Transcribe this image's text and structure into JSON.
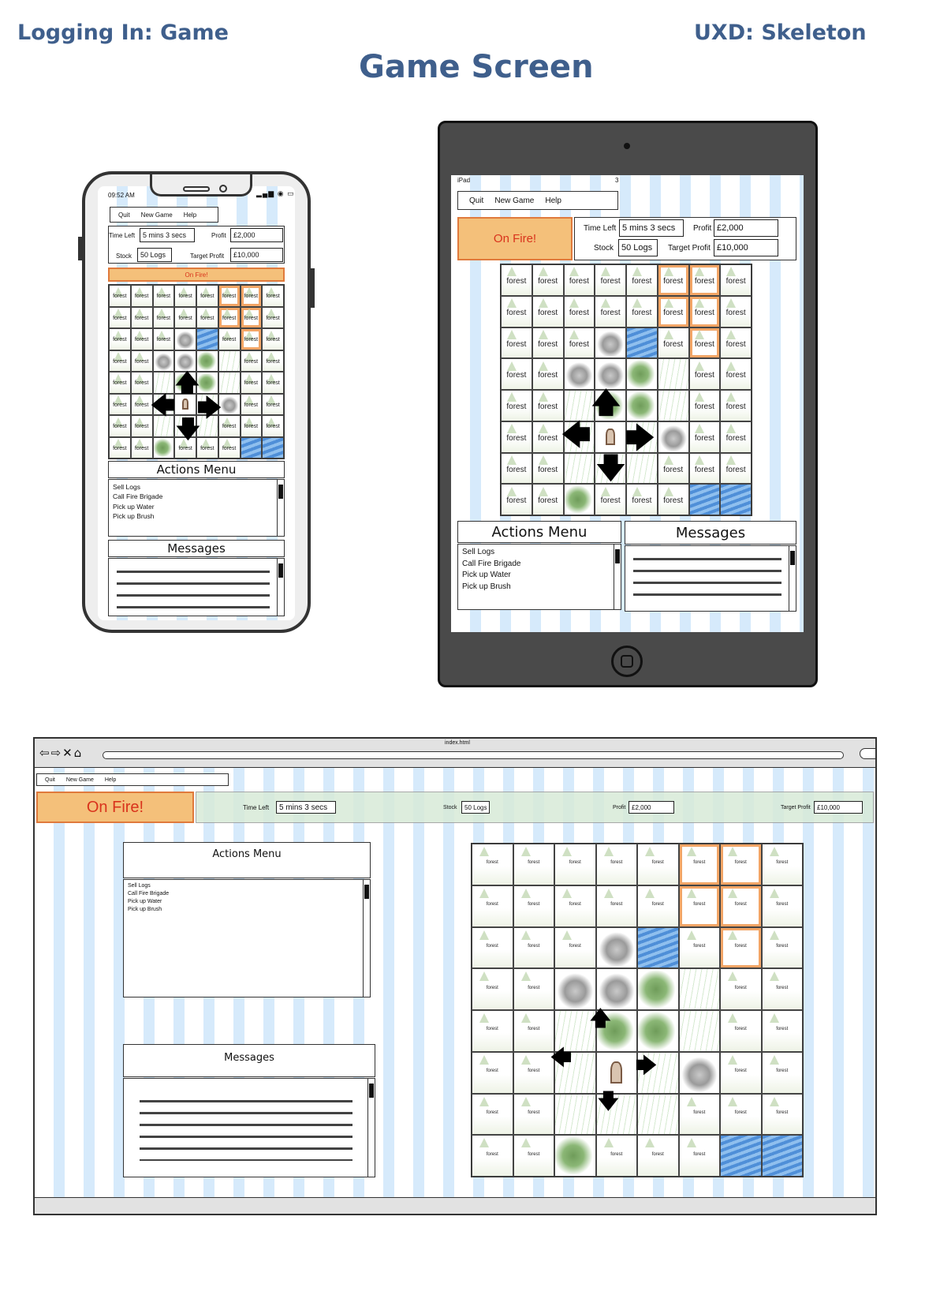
{
  "header": {
    "left": "Logging In: Game",
    "right": "UXD: Skeleton",
    "title": "Game Screen"
  },
  "menu": {
    "quit": "Quit",
    "new_game": "New Game",
    "help": "Help"
  },
  "status": {
    "alert": "On Fire!",
    "time_left_label": "Time Left",
    "time_left_value": "5 mins 3 secs",
    "profit_label": "Profit",
    "profit_value": "£2,000",
    "stock_label": "Stock",
    "stock_value": "50 Logs",
    "target_profit_label": "Target Profit",
    "target_profit_value": "£10,000"
  },
  "actions": {
    "title": "Actions Menu",
    "items": [
      "Sell Logs",
      "Call Fire Brigade",
      "Pick up Water",
      "Pick up Brush"
    ]
  },
  "messages": {
    "title": "Messages"
  },
  "map": {
    "tile_label": "forest",
    "rows": [
      [
        "forest",
        "forest",
        "forest",
        "forest",
        "forest",
        "fire",
        "fire",
        "forest"
      ],
      [
        "forest",
        "forest",
        "forest",
        "forest",
        "forest",
        "fire",
        "fire",
        "forest"
      ],
      [
        "forest",
        "forest",
        "forest",
        "rock",
        "water",
        "forest",
        "fire",
        "forest"
      ],
      [
        "forest",
        "forest",
        "rock",
        "rock",
        "brush",
        "grass",
        "forest",
        "forest"
      ],
      [
        "forest",
        "forest",
        "grass",
        "brush",
        "brush",
        "grass",
        "forest",
        "forest"
      ],
      [
        "forest",
        "forest",
        "grass",
        "home",
        "grass",
        "rock",
        "forest",
        "forest"
      ],
      [
        "forest",
        "forest",
        "grass",
        "grass",
        "grass",
        "forest",
        "forest",
        "forest"
      ],
      [
        "forest",
        "forest",
        "brush",
        "forest",
        "forest",
        "forest",
        "water",
        "water"
      ]
    ]
  },
  "phone": {
    "time": "09:52 AM"
  },
  "tablet": {
    "status_left": "iPad",
    "status_mid": "3"
  },
  "browser": {
    "page_title": "index.html"
  },
  "colors": {
    "header_blue": "#3f5f8c",
    "fire_fill": "#f4c07a",
    "fire_text": "#d9331c",
    "water": "#4f8fd8"
  }
}
